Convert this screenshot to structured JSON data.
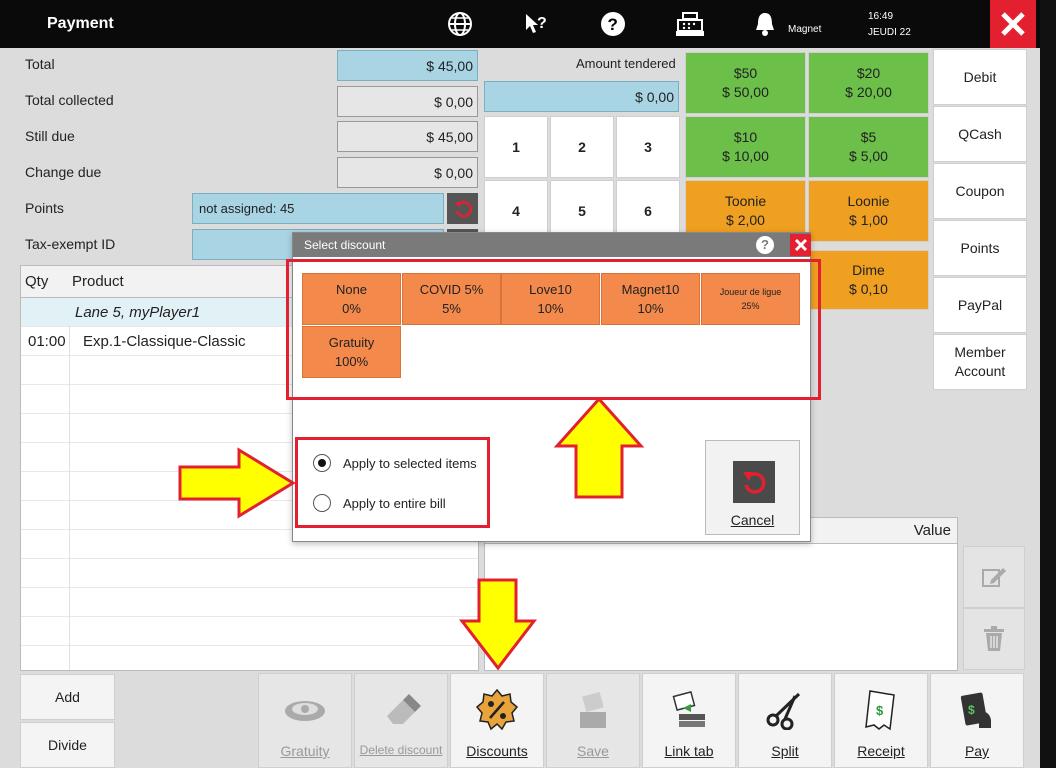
{
  "header": {
    "title": "Payment",
    "user_label": "Magnet",
    "time": "16:49",
    "date": "JEUDI 22",
    "icons": [
      "globe-icon",
      "help-cursor-icon",
      "question-icon",
      "cash-register-icon",
      "bell-icon",
      "close-icon"
    ]
  },
  "totals": {
    "total_label": "Total",
    "total_value": "$ 45,00",
    "collected_label": "Total collected",
    "collected_value": "$ 0,00",
    "due_label": "Still due",
    "due_value": "$ 45,00",
    "change_label": "Change due",
    "change_value": "$ 0,00",
    "points_label": "Points",
    "points_value": "not assigned: 45",
    "taxid_label": "Tax-exempt ID",
    "taxid_value": ""
  },
  "product_list": {
    "headers": {
      "qty": "Qty",
      "product": "Product"
    },
    "group": "Lane 5, myPlayer1",
    "rows": [
      {
        "qty": "01:00",
        "product": "Exp.1-Classique-Classic"
      }
    ]
  },
  "tender": {
    "label": "Amount tendered",
    "value": "$ 0,00",
    "keys": [
      "1",
      "2",
      "3",
      "4",
      "5",
      "6"
    ]
  },
  "cash_buttons": [
    {
      "title": "$50",
      "amount": "$ 50,00",
      "color": "#6cc04a"
    },
    {
      "title": "$20",
      "amount": "$ 20,00",
      "color": "#6cc04a"
    },
    {
      "title": "$10",
      "amount": "$ 10,00",
      "color": "#6cc04a"
    },
    {
      "title": "$5",
      "amount": "$ 5,00",
      "color": "#6cc04a"
    },
    {
      "title": "Toonie",
      "amount": "$ 2,00",
      "color": "#f0a020"
    },
    {
      "title": "Loonie",
      "amount": "$ 1,00",
      "color": "#f0a020"
    },
    {
      "title": "Dime",
      "amount": "$ 0,10",
      "color": "#f0a020"
    }
  ],
  "payment_types": [
    "Debit",
    "QCash",
    "Coupon",
    "Points",
    "PayPal",
    "Member Account"
  ],
  "value_list": {
    "header": "Value"
  },
  "side_buttons": {
    "add": "Add",
    "divide": "Divide"
  },
  "toolbar": [
    {
      "label": "Gratuity",
      "icon": "gratuity-icon",
      "enabled": false
    },
    {
      "label": "Delete discount",
      "icon": "eraser-icon",
      "enabled": false
    },
    {
      "label": "Discounts",
      "icon": "discount-icon",
      "enabled": true
    },
    {
      "label": "Save",
      "icon": "save-icon",
      "enabled": false
    },
    {
      "label": "Link tab",
      "icon": "link-tab-icon",
      "enabled": true
    },
    {
      "label": "Split",
      "icon": "scissors-icon",
      "enabled": true
    },
    {
      "label": "Receipt",
      "icon": "receipt-icon",
      "enabled": true
    },
    {
      "label": "Pay",
      "icon": "pay-icon",
      "enabled": true
    }
  ],
  "dialog": {
    "title": "Select discount",
    "discounts": [
      {
        "name": "None",
        "value": "0%"
      },
      {
        "name": "COVID 5%",
        "value": "5%"
      },
      {
        "name": "Love10",
        "value": "10%"
      },
      {
        "name": "Magnet10",
        "value": "10%"
      },
      {
        "name": "Joueur de ligue",
        "value": "25%"
      },
      {
        "name": "Gratuity",
        "value": "100%"
      }
    ],
    "apply_selected": "Apply to selected items",
    "apply_entire": "Apply to entire bill",
    "selected_option": "Apply to selected items",
    "cancel": "Cancel"
  },
  "colors": {
    "accent_red": "#e3202f",
    "discount_orange": "#f3894a",
    "highlight_yellow": "#ffff00"
  }
}
